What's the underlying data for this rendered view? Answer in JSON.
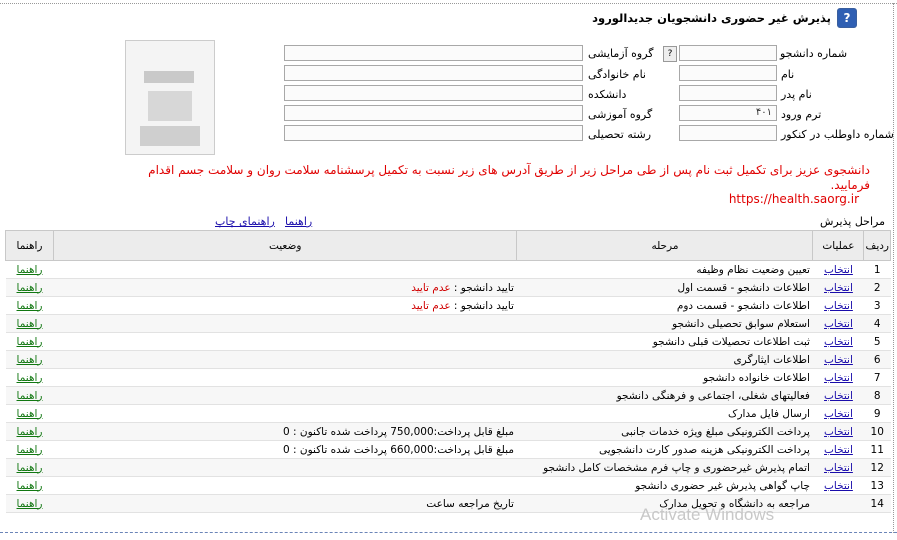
{
  "header": {
    "title": "پذیرش غیر حضوری دانشجویان جدیدالورود",
    "help_icon": "question-icon"
  },
  "fields": {
    "student_no_label": "شماره دانشجو",
    "exam_group_label": "گروه آزمایشی",
    "first_name_label": "نام",
    "last_name_label": "نام خانوادگی",
    "father_name_label": "نام پدر",
    "faculty_label": "دانشکده",
    "entry_term_label": "ترم ورود",
    "edu_group_label": "گروه آموزشی",
    "konkur_no_label": "شماره داوطلب در کنکور",
    "major_label": "رشته تحصیلی",
    "entry_term_value": "۴۰۱"
  },
  "notice": "دانشجوی عزیز برای تکمیل ثبت نام پس از طی مراحل زیر از طریق آدرس های زیر نسبت به تکمیل پرسشنامه سلامت روان و سلامت جسم اقدام فرمایید.",
  "notice_url": "https://health.saorg.ir",
  "stages": {
    "label": "مراحل پذیرش",
    "guide_link": "راهنما",
    "print_guide_link": "راهنمای چاپ"
  },
  "table": {
    "headers": {
      "num": "ردیف",
      "op": "عملیات",
      "stage": "مرحله",
      "status": "وضعیت",
      "guide": "راهنما"
    },
    "rows": [
      {
        "num": "1",
        "op": "انتخاب",
        "stage": "تعیین وضعیت نظام وظیفه",
        "status_black": "",
        "status_red": "",
        "guide": "راهنما"
      },
      {
        "num": "2",
        "op": "انتخاب",
        "stage": "اطلاعات دانشجو - قسمت اول",
        "status_black": "تایید دانشجو : ",
        "status_red": "عدم تایید",
        "guide": "راهنما"
      },
      {
        "num": "3",
        "op": "انتخاب",
        "stage": "اطلاعات دانشجو - قسمت دوم",
        "status_black": "تایید دانشجو : ",
        "status_red": "عدم تایید",
        "guide": "راهنما"
      },
      {
        "num": "4",
        "op": "انتخاب",
        "stage": "استعلام سوابق تحصیلی دانشجو",
        "status_black": "",
        "status_red": "",
        "guide": "راهنما"
      },
      {
        "num": "5",
        "op": "انتخاب",
        "stage": "ثبت اطلاعات تحصیلات قبلی دانشجو",
        "status_black": "",
        "status_red": "",
        "guide": "راهنما"
      },
      {
        "num": "6",
        "op": "انتخاب",
        "stage": "اطلاعات ایثارگری",
        "status_black": "",
        "status_red": "",
        "guide": "راهنما"
      },
      {
        "num": "7",
        "op": "انتخاب",
        "stage": "اطلاعات خانواده دانشجو",
        "status_black": "",
        "status_red": "",
        "guide": "راهنما"
      },
      {
        "num": "8",
        "op": "انتخاب",
        "stage": "فعالیتهای شغلی، اجتماعی و فرهنگی دانشجو",
        "status_black": "",
        "status_red": "",
        "guide": "راهنما"
      },
      {
        "num": "9",
        "op": "انتخاب",
        "stage": "ارسال فایل مدارک",
        "status_black": "",
        "status_red": "",
        "guide": "راهنما"
      },
      {
        "num": "10",
        "op": "انتخاب",
        "stage": "پرداخت الکترونیکی مبلغ ویژه خدمات جانبی",
        "status_black": "مبلغ قابل پرداخت:750,000 پرداخت شده تاکنون : 0",
        "status_red": "",
        "guide": "راهنما"
      },
      {
        "num": "11",
        "op": "انتخاب",
        "stage": "پرداخت الکترونیکی هزینه صدور کارت دانشجویی",
        "status_black": "مبلغ قابل پرداخت:660,000 پرداخت شده تاکنون : 0",
        "status_red": "",
        "guide": "راهنما"
      },
      {
        "num": "12",
        "op": "انتخاب",
        "stage": "اتمام پذیرش غیرحضوری و چاپ فرم مشخصات کامل دانشجو",
        "status_black": "",
        "status_red": "",
        "guide": "راهنما"
      },
      {
        "num": "13",
        "op": "انتخاب",
        "stage": "چاپ گواهی پذیرش غیر حضوری دانشجو",
        "status_black": "",
        "status_red": "",
        "guide": "راهنما"
      },
      {
        "num": "14",
        "op": "",
        "stage": "مراجعه به دانشگاه و تحویل مدارک",
        "status_black": "تاریخ مراجعه ساعت",
        "status_red": "",
        "guide": "راهنما"
      }
    ]
  },
  "watermark": "Activate Windows"
}
